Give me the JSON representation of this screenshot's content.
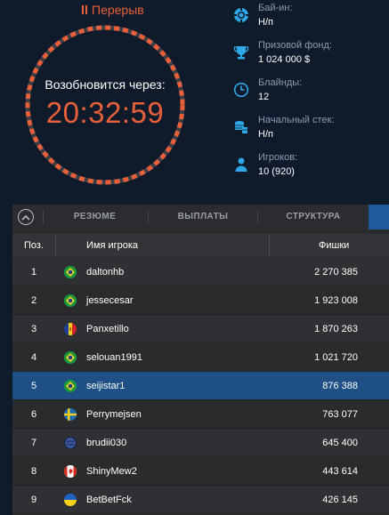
{
  "status": {
    "label": "Перерыв"
  },
  "timer": {
    "caption": "Возобновится через:",
    "time": "20:32:59",
    "ring_color": "#e8603a"
  },
  "info": [
    {
      "icon": "poker-chip-icon",
      "label": "Бай-ин:",
      "value": "Н/п"
    },
    {
      "icon": "trophy-icon",
      "label": "Призовой фонд:",
      "value": "1 024 000 $"
    },
    {
      "icon": "clock-icon",
      "label": "Блайнды:",
      "value": "12"
    },
    {
      "icon": "chip-stack-icon",
      "label": "Начальный стек:",
      "value": "Н/п"
    },
    {
      "icon": "player-icon",
      "label": "Игроков:",
      "value": "10 (920)"
    }
  ],
  "tabs": [
    {
      "label": "РЕЗЮМЕ"
    },
    {
      "label": "ВЫПЛАТЫ"
    },
    {
      "label": "СТРУКТУРА БЛАЙНДОВ"
    }
  ],
  "table": {
    "headers": {
      "pos": "Поз.",
      "name": "Имя игрока",
      "chips": "Фишки"
    },
    "rows": [
      {
        "pos": "1",
        "flag": "brazil-flag-icon",
        "name": "daltonhb",
        "chips": "2 270 385",
        "highlighted": false
      },
      {
        "pos": "2",
        "flag": "brazil-flag-icon",
        "name": "jessecesar",
        "chips": "1 923 008",
        "highlighted": false
      },
      {
        "pos": "3",
        "flag": "andorra-flag-icon",
        "name": "Panxetillo",
        "chips": "1 870 263",
        "highlighted": false
      },
      {
        "pos": "4",
        "flag": "brazil-flag-icon",
        "name": "selouan1991",
        "chips": "1 021 720",
        "highlighted": false
      },
      {
        "pos": "5",
        "flag": "brazil-flag-icon",
        "name": "seijistar1",
        "chips": "876 388",
        "highlighted": true
      },
      {
        "pos": "6",
        "flag": "sweden-flag-icon",
        "name": "Perrymejsen",
        "chips": "763 077",
        "highlighted": false
      },
      {
        "pos": "7",
        "flag": "globe-flag-icon",
        "name": "brudii030",
        "chips": "645 400",
        "highlighted": false
      },
      {
        "pos": "8",
        "flag": "canada-flag-icon",
        "name": "ShinyMew2",
        "chips": "443 614",
        "highlighted": false
      },
      {
        "pos": "9",
        "flag": "ukraine-flag-icon",
        "name": "BetBetFck",
        "chips": "426 145",
        "highlighted": false
      }
    ]
  },
  "colors": {
    "accent_orange": "#e8603a",
    "icon_blue": "#2ea8e6",
    "highlight_row": "#1e4f85",
    "background": "#0f1a2b"
  }
}
